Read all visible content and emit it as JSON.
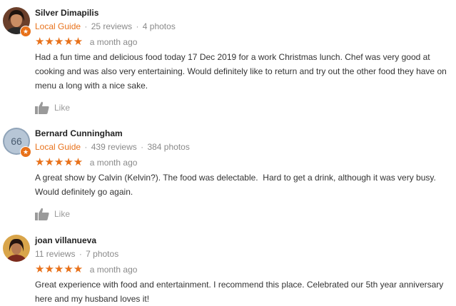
{
  "reviews": [
    {
      "name": "Silver Dimapilis",
      "badge": "Local Guide",
      "reviews": "25 reviews",
      "photos": "4 photos",
      "separator": "·",
      "stars": "★★★★★",
      "rating": 5,
      "date": "a month ago",
      "text": "Had a fun time and delicious food today 17 Dec 2019 for a work Christmas lunch. Chef was very good at cooking and was also very entertaining. Would definitely like to return and try out the other food they have on menu a long with a nice sake.",
      "like_label": "Like",
      "avatar_badge_icon": "local-guide-star-icon"
    },
    {
      "name": "Bernard Cunningham",
      "badge": "Local Guide",
      "reviews": "439 reviews",
      "photos": "384 photos",
      "separator": "·",
      "stars": "★★★★★",
      "rating": 5,
      "date": "a month ago",
      "text": "A great show by Calvin (Kelvin?). The food was delectable.  Hard to get a drink, although it was very busy. Would definitely go again.",
      "like_label": "Like",
      "avatar_text": "66"
    },
    {
      "name": "joan villanueva",
      "reviews": "11 reviews",
      "photos": "7 photos",
      "separator": "·",
      "stars": "★★★★★",
      "rating": 5,
      "date": "a month ago",
      "text": "Great experience with food and entertainment. I recommend this place. Celebrated our 5th year anniversary here and my husband loves it!"
    }
  ],
  "colors": {
    "accent": "#e8711a",
    "muted": "#8a8a8a",
    "text": "#333333"
  }
}
